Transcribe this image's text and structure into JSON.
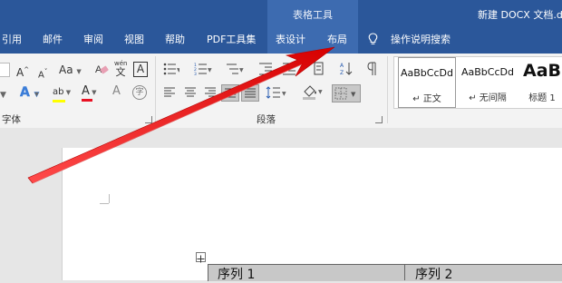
{
  "window": {
    "contextual_group": "表格工具",
    "doc_title": "新建 DOCX 文档.d"
  },
  "tabs": [
    "引用",
    "邮件",
    "审阅",
    "视图",
    "帮助",
    "PDF工具集",
    "表设计",
    "布局"
  ],
  "tell_me": "操作说明搜索",
  "ribbon": {
    "font_group_label": "字体",
    "paragraph_group_label": "段落",
    "grow_font": "A",
    "shrink_font": "A",
    "change_case": "Aa",
    "phonetic_top": "wén",
    "phonetic_bottom": "文",
    "char_border": "A",
    "text_effects": "A",
    "highlight": "ab",
    "font_color": "A",
    "enclose_char": "字",
    "font_color_hex": "#e81123",
    "highlight_color_hex": "#ffff00"
  },
  "styles": [
    {
      "sample": "AaBbCcDd",
      "name": "正文"
    },
    {
      "sample": "AaBbCcDd",
      "name": "无间隔"
    },
    {
      "sample": "AaB",
      "name": "标题 1"
    }
  ],
  "table": {
    "cells": [
      "序列 1",
      "序列 2"
    ]
  },
  "colors": {
    "title_bar": "#2b579a",
    "contextual_tab": "#3d6bb0",
    "arrow": "#e81010"
  }
}
